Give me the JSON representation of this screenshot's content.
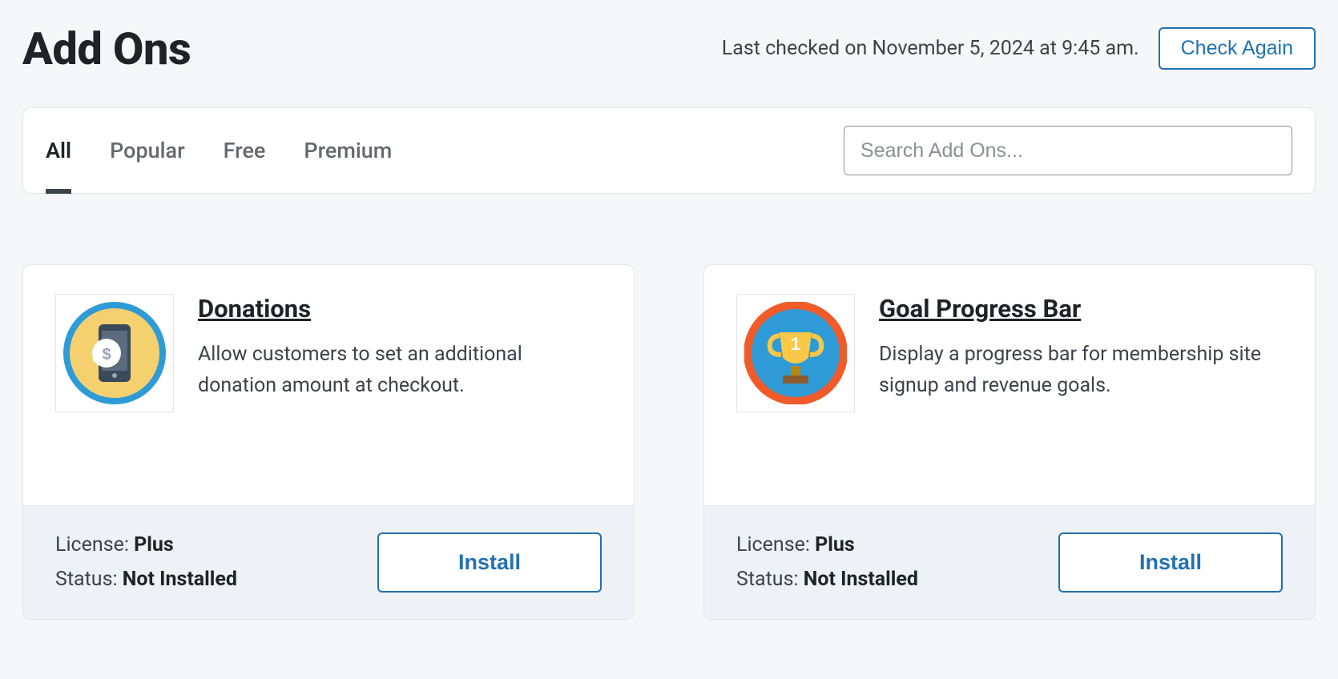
{
  "header": {
    "title": "Add Ons",
    "last_checked": "Last checked on November 5, 2024 at 9:45 am.",
    "check_again": "Check Again"
  },
  "tabs": {
    "all": "All",
    "popular": "Popular",
    "free": "Free",
    "premium": "Premium"
  },
  "search": {
    "placeholder": "Search Add Ons..."
  },
  "labels": {
    "license": "License:",
    "status": "Status:",
    "install": "Install"
  },
  "cards": [
    {
      "title": "Donations",
      "desc": "Allow customers to set an additional donation amount at checkout.",
      "license": "Plus",
      "status": "Not Installed",
      "icon": "donations-icon"
    },
    {
      "title": "Goal Progress Bar",
      "desc": "Display a progress bar for membership site signup and revenue goals.",
      "license": "Plus",
      "status": "Not Installed",
      "icon": "trophy-icon"
    }
  ]
}
